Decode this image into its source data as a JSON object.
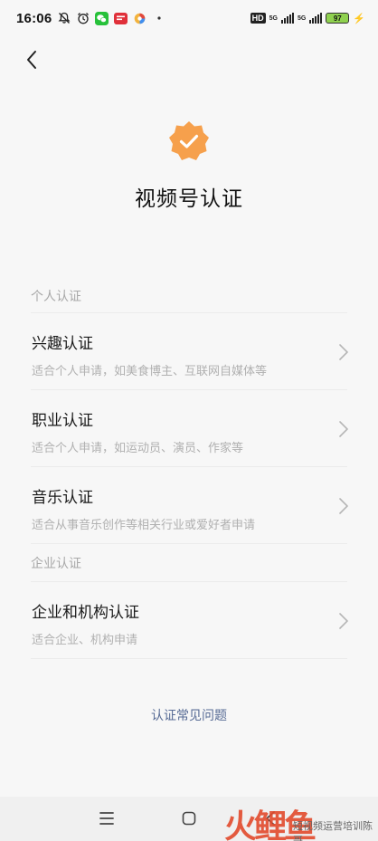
{
  "status_bar": {
    "time": "16:06",
    "hd_label": "HD",
    "net1": "5G",
    "net2": "5G",
    "battery": "97"
  },
  "page": {
    "title": "视频号认证"
  },
  "sections": [
    {
      "label": "个人认证",
      "items": [
        {
          "title": "兴趣认证",
          "desc": "适合个人申请，如美食博主、互联网自媒体等"
        },
        {
          "title": "职业认证",
          "desc": "适合个人申请，如运动员、演员、作家等"
        },
        {
          "title": "音乐认证",
          "desc": "适合从事音乐创作等相关行业或爱好者申请"
        }
      ]
    },
    {
      "label": "企业认证",
      "items": [
        {
          "title": "企业和机构认证",
          "desc": "适合企业、机构申请"
        }
      ]
    }
  ],
  "faq_link": "认证常见问题",
  "watermark": {
    "big": "火鲤鱼",
    "small": "短视频运营培训陈哥"
  },
  "colors": {
    "badge": "#f6a04c",
    "link": "#576b95",
    "background": "#f7f7f7"
  }
}
